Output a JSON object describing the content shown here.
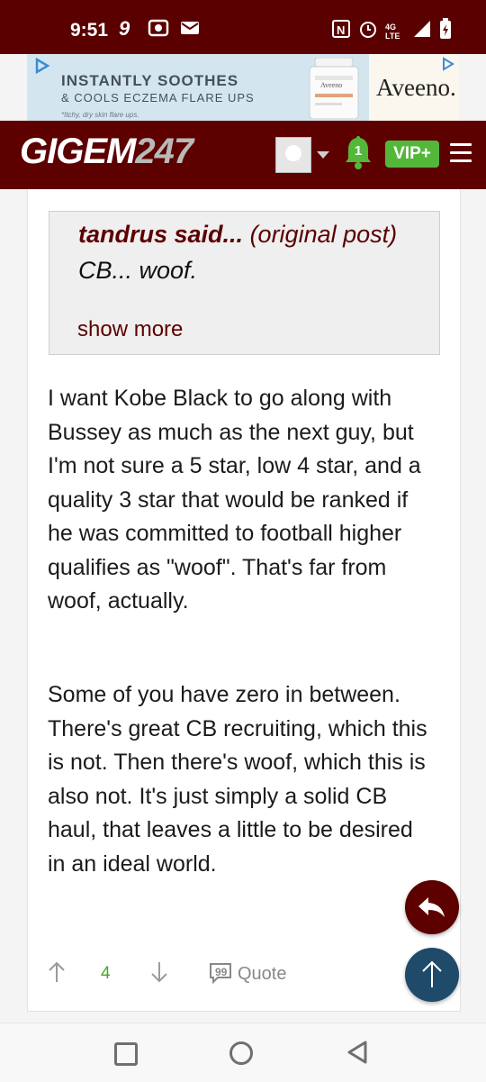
{
  "status_bar": {
    "time": "9:51",
    "network": "4G LTE"
  },
  "ad": {
    "line1": "INSTANTLY SOOTHES",
    "line2": "& COOLS ECZEMA FLARE UPS",
    "line3": "*Itchy, dry skin flare ups.",
    "brand": "Aveeno.",
    "product_label": "Aveeno"
  },
  "header": {
    "logo_main": "GIGEM",
    "logo_num": "247",
    "notification_count": "1",
    "vip_label": "VIP+"
  },
  "post": {
    "quote_author": "tandrus said...",
    "quote_source": "(original post)",
    "quote_text": "CB... woof.",
    "show_more": "show more",
    "paragraph1": "I want Kobe Black to go along with Bussey as much as the next guy, but I'm not sure a 5 star, low 4 star, and a quality 3 star that would be ranked if he was committed to football higher qualifies as \"woof\". That's far from woof, actually.",
    "paragraph2": "Some of you have zero in between. There's great CB recruiting, which this is not. Then there's woof, which this is also not. It's just simply a solid CB haul, that leaves a little to be desired in an ideal world.",
    "vote_count": "4",
    "quote_label": "Quote"
  },
  "colors": {
    "brand_maroon": "#5c0000",
    "vip_green": "#53b83a",
    "scroll_top_blue": "#1f4a6a"
  }
}
